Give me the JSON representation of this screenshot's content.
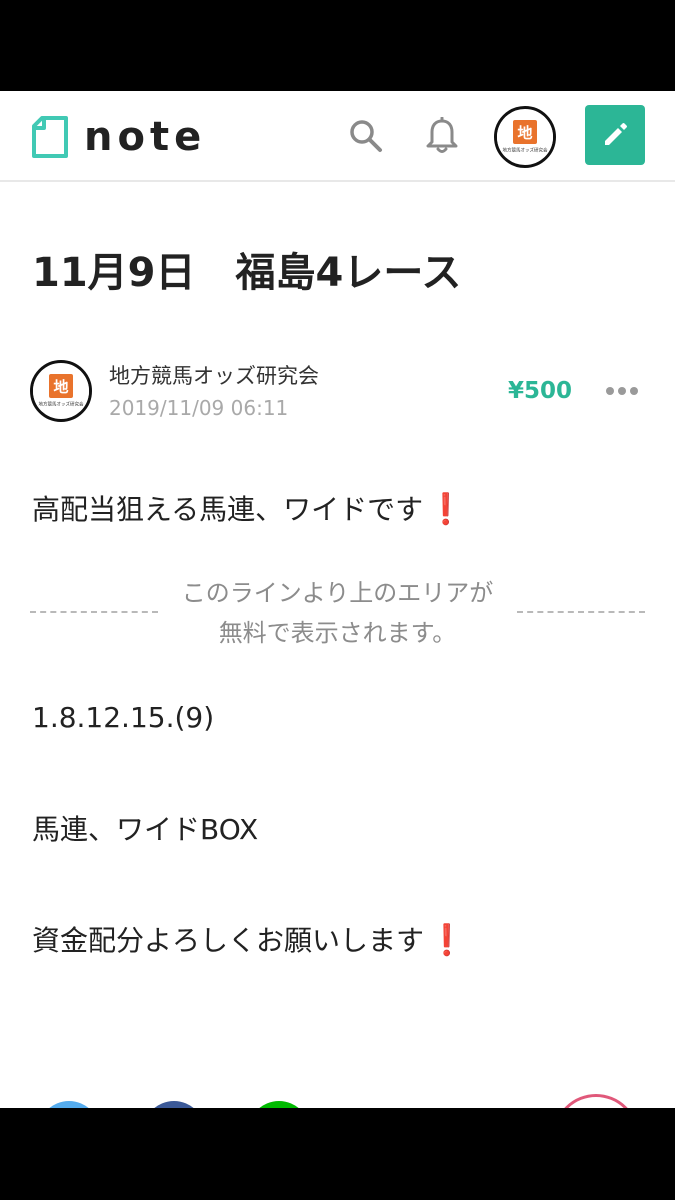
{
  "header": {
    "logo_text": "note",
    "avatar_badge": "地",
    "avatar_caption": "地方競馬オッズ研究会"
  },
  "article": {
    "title": "11月9日　福島4レース",
    "author_name": "地方競馬オッズ研究会",
    "post_date": "2019/11/09 06:11",
    "price": "¥500",
    "intro": "高配当狙える馬連、ワイドです",
    "paywall_line1": "このラインより上のエリアが",
    "paywall_line2": "無料で表示されます。",
    "numbers": "1.8.12.15.(9)",
    "bet_type": "馬連、ワイドBOX",
    "closing": "資金配分よろしくお願いします",
    "exclamation": "❗"
  },
  "colors": {
    "brand_green": "#2cb696",
    "accent_red": "#d0202a",
    "avatar_orange": "#e9732c"
  },
  "icons": [
    "note-logo-icon",
    "search-icon",
    "bell-icon",
    "pencil-icon",
    "more-dots-icon"
  ]
}
